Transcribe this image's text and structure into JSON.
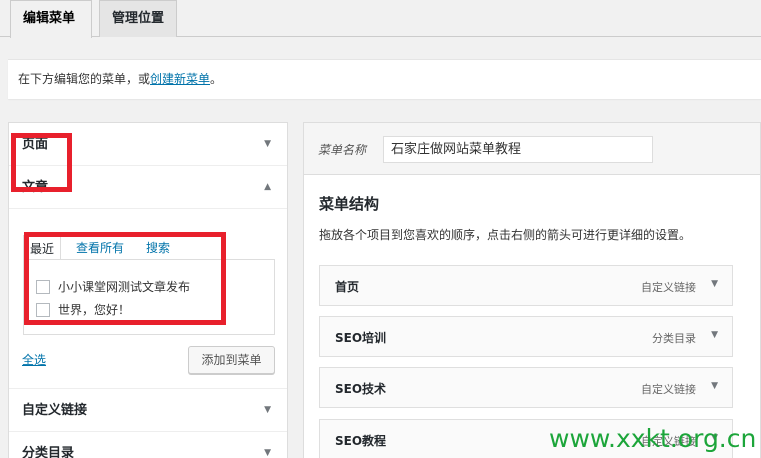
{
  "tabs": [
    {
      "label": "编辑菜单",
      "active": true
    },
    {
      "label": "管理位置",
      "active": false
    }
  ],
  "notice": {
    "text": "在下方编辑您的菜单，或",
    "link": "创建新菜单",
    "suffix": "。"
  },
  "left": {
    "sections": [
      {
        "label": "页面",
        "expanded": false
      },
      {
        "label": "文章",
        "expanded": true
      },
      {
        "label": "自定义链接",
        "expanded": false
      },
      {
        "label": "分类目录",
        "expanded": false
      }
    ],
    "subtabs": [
      "最近",
      "查看所有",
      "搜索"
    ],
    "items": [
      "小小课堂网测试文章发布",
      "世界，您好！"
    ],
    "select_all": "全选",
    "add_button": "添加到菜单"
  },
  "right": {
    "name_label": "菜单名称",
    "name_value": "石家庄做网站菜单教程",
    "structure_title": "菜单结构",
    "structure_desc": "拖放各个项目到您喜欢的顺序，点击右侧的箭头可进行更详细的设置。",
    "menu_items": [
      {
        "title": "首页",
        "type": "自定义链接"
      },
      {
        "title": "SEO培训",
        "type": "分类目录"
      },
      {
        "title": "SEO技术",
        "type": "自定义链接"
      },
      {
        "title": "SEO教程",
        "type": "自定义链接"
      }
    ]
  },
  "icons": {
    "arrow_down": "▼",
    "arrow_up": "▲"
  },
  "colors": {
    "link": "#0073aa",
    "highlight": "#e8202c",
    "watermark": "#1ca53a"
  },
  "watermark": "www.xxkt.org.cn"
}
